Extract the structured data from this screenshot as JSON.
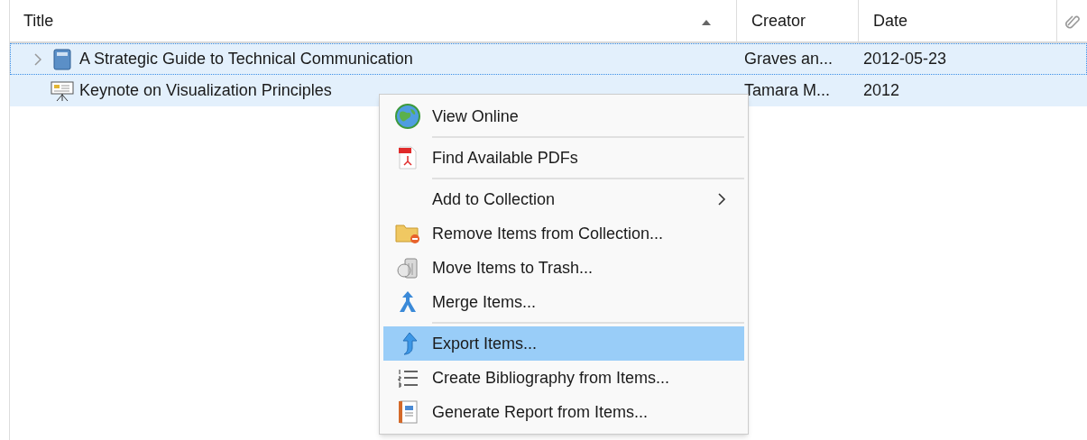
{
  "columns": [
    {
      "label": "Title",
      "sorted": true
    },
    {
      "label": "Creator",
      "sorted": false
    },
    {
      "label": "Date",
      "sorted": false
    }
  ],
  "rows": [
    {
      "kind": "book",
      "expandable": true,
      "focused": true,
      "selected": true,
      "title": "A Strategic Guide to Technical Communication",
      "creator": "Graves an...",
      "date": "2012-05-23"
    },
    {
      "kind": "presentation",
      "expandable": false,
      "focused": false,
      "selected": true,
      "title": "Keynote on Visualization Principles",
      "creator": "Tamara M...",
      "date": "2012"
    }
  ],
  "context_menu": {
    "items": [
      {
        "label": "View Online",
        "selected": false,
        "submenu": false,
        "separator_after": true
      },
      {
        "label": "Find Available PDFs",
        "selected": false,
        "submenu": false,
        "separator_after": true
      },
      {
        "label": "Add to Collection",
        "selected": false,
        "submenu": true,
        "separator_after": false
      },
      {
        "label": "Remove Items from Collection...",
        "selected": false,
        "submenu": false,
        "separator_after": false
      },
      {
        "label": "Move Items to Trash...",
        "selected": false,
        "submenu": false,
        "separator_after": false
      },
      {
        "label": "Merge Items...",
        "selected": false,
        "submenu": false,
        "separator_after": true
      },
      {
        "label": "Export Items...",
        "selected": true,
        "submenu": false,
        "separator_after": false
      },
      {
        "label": "Create Bibliography from Items...",
        "selected": false,
        "submenu": false,
        "separator_after": false
      },
      {
        "label": "Generate Report from Items...",
        "selected": false,
        "submenu": false,
        "separator_after": false
      }
    ]
  }
}
